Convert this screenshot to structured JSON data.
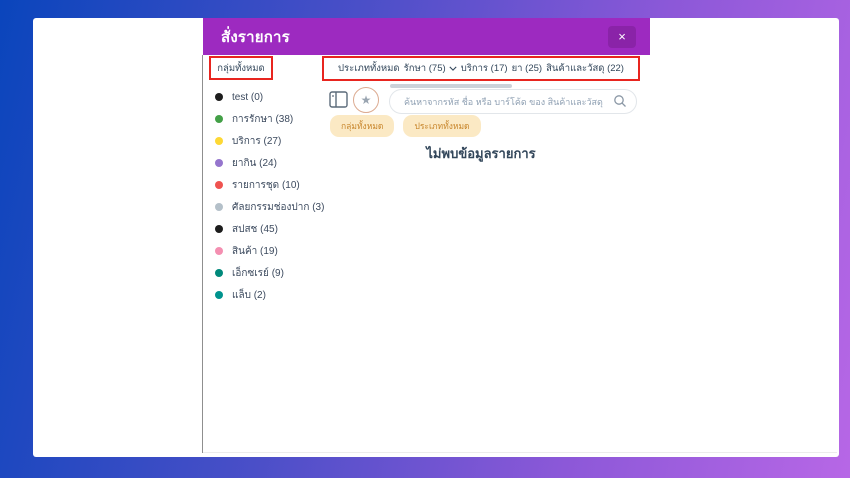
{
  "modal": {
    "title": "สั่งรายการ",
    "close_label": "×"
  },
  "sidebar": {
    "all_groups_label": "กลุ่มทั้งหมด",
    "items": [
      {
        "label": "test (0)",
        "color": "#1d1d1d"
      },
      {
        "label": "การรักษา (38)",
        "color": "#43a047"
      },
      {
        "label": "บริการ (27)",
        "color": "#fdd835"
      },
      {
        "label": "ยากิน (24)",
        "color": "#9575cd"
      },
      {
        "label": "รายการชุด (10)",
        "color": "#ef5350"
      },
      {
        "label": "ศัลยกรรมช่องปาก (3)",
        "color": "#b4c0c9"
      },
      {
        "label": "สปสช (45)",
        "color": "#1d1d1d"
      },
      {
        "label": "สินค้า (19)",
        "color": "#f48fb1"
      },
      {
        "label": "เอ็กซเรย์ (9)",
        "color": "#00897b"
      },
      {
        "label": "แล็บ (2)",
        "color": "#00938e"
      }
    ]
  },
  "tabs": [
    {
      "label": "ประเภททั้งหมด",
      "has_chevron": false
    },
    {
      "label": "รักษา (75)",
      "has_chevron": true
    },
    {
      "label": "บริการ (17)",
      "has_chevron": false
    },
    {
      "label": "ยา (25)",
      "has_chevron": false
    },
    {
      "label": "สินค้าและวัสดุ (22)",
      "has_chevron": false
    }
  ],
  "search": {
    "placeholder": "ค้นหาจากรหัส ชื่อ หรือ บาร์โค้ด ของ สินค้าและวัสดุ",
    "value": ""
  },
  "filter_chips": [
    {
      "label": "กลุ่มทั้งหมด"
    },
    {
      "label": "ประเภททั้งหมด"
    }
  ],
  "empty_message": "ไม่พบข้อมูลรายการ",
  "icons": {
    "star": "★",
    "layout": "layout-panel-icon",
    "search": "magnifier-icon",
    "chevron": "chevron-down-icon"
  },
  "colors": {
    "header_purple": "#9d2ac0",
    "close_button_purple": "#8a23a8",
    "annotation_red": "#e8251f",
    "chip_bg": "#fbe9c4",
    "chip_text": "#c8862c",
    "text_dark": "#33475b",
    "bg_gradient_start": "#0a45bc",
    "bg_gradient_end": "#b767e6"
  }
}
